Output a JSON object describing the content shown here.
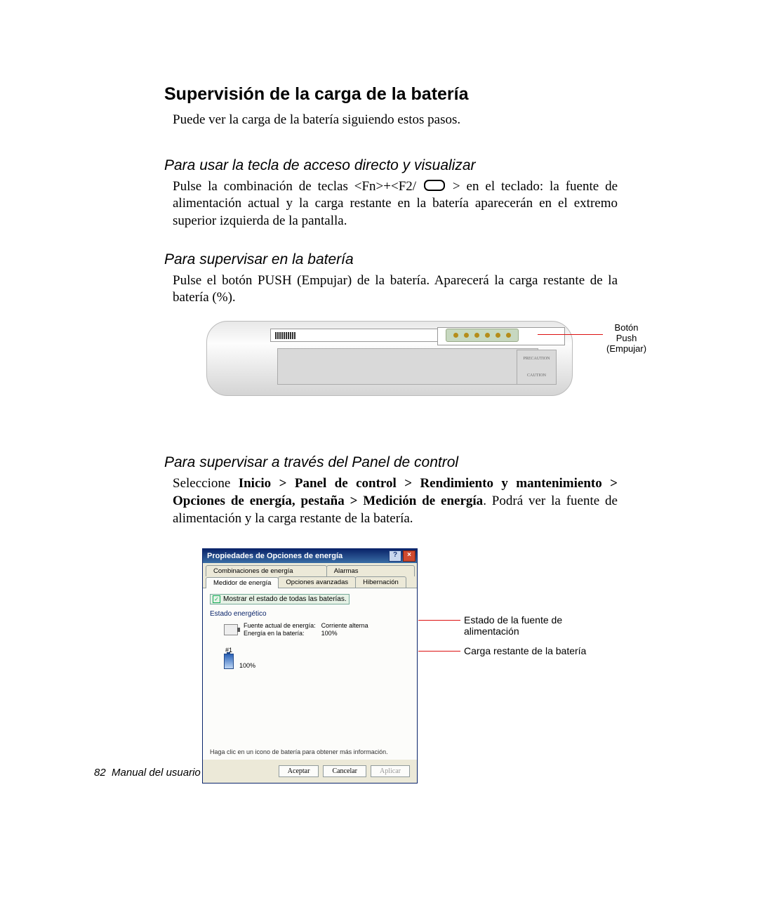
{
  "h1": "Supervisión de la carga de la batería",
  "intro": "Puede ver la carga de la batería siguiendo estos pasos.",
  "sec1": {
    "title": "Para usar la tecla de acceso directo y visualizar",
    "p_a": "Pulse la combinación de teclas <Fn>+<F2/",
    "p_b": "> en el teclado: la fuente de alimentación actual y la carga restante en la batería aparecerán en el extremo superior izquierda de la pantalla."
  },
  "sec2": {
    "title": "Para supervisar en la batería",
    "p": "Pulse el botón PUSH (Empujar) de la batería. Aparecerá la carga restante de la batería (%).",
    "callout1": "Botón Push",
    "callout2": "(Empujar)"
  },
  "sec3": {
    "title": "Para supervisar a través del Panel de control",
    "p_a": "Seleccione ",
    "p_bold": "Inicio > Panel de control > Rendimiento y mantenimiento > Opciones de energía, pestaña > Medición de energía",
    "p_b": ". Podrá ver la fuente de alimentación y la carga restante de la batería.",
    "callout1": "Estado de la fuente de alimentación",
    "callout2": "Carga restante de la batería"
  },
  "dialog": {
    "title": "Propiedades de Opciones de energía",
    "tabs": {
      "t1": "Combinaciones de energía",
      "t2": "Alarmas",
      "t3": "Medidor de energía",
      "t4": "Opciones avanzadas",
      "t5": "Hibernación"
    },
    "checkbox": "Mostrar el estado de todas las baterías.",
    "group": "Estado energético",
    "src_label": "Fuente actual de energía:",
    "src_value": "Corriente alterna",
    "bat_label": "Energía en la batería:",
    "bat_value": "100%",
    "b1": "#1",
    "b1v": "100%",
    "hint": "Haga clic en un icono de batería para obtener más información.",
    "ok": "Aceptar",
    "cancel": "Cancelar",
    "apply": "Aplicar"
  },
  "footer_page": "82",
  "footer_text": "Manual del usuario"
}
